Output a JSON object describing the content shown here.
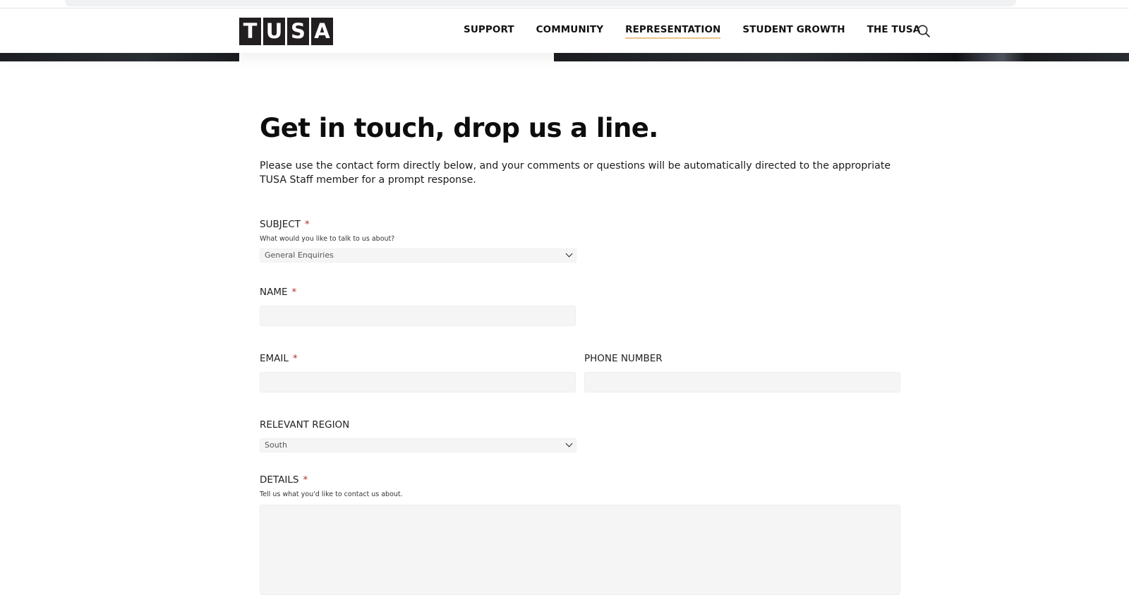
{
  "header": {
    "logo_letters": [
      "T",
      "U",
      "S",
      "A"
    ],
    "nav": [
      {
        "label": "SUPPORT",
        "active": false
      },
      {
        "label": "COMMUNITY",
        "active": false
      },
      {
        "label": "REPRESENTATION",
        "active": true
      },
      {
        "label": "STUDENT GROWTH",
        "active": false
      },
      {
        "label": "THE TUSA",
        "active": false
      }
    ],
    "search_icon": "search-icon"
  },
  "main": {
    "title": "Get in touch, drop us a line.",
    "intro": "Please use the contact form directly below, and your comments or questions will be automatically directed to the appropriate TUSA Staff member for a prompt response."
  },
  "form": {
    "required_marker": "*",
    "subject": {
      "label": "SUBJECT",
      "hint": "What would you like to talk to us about?",
      "value": "General Enquiries"
    },
    "name": {
      "label": "NAME",
      "value": ""
    },
    "email": {
      "label": "EMAIL",
      "value": ""
    },
    "phone": {
      "label": "PHONE NUMBER",
      "value": ""
    },
    "region": {
      "label": "RELEVANT REGION",
      "value": "South"
    },
    "details": {
      "label": "DETAILS",
      "hint": "Tell us what you'd like to contact us about.",
      "value": ""
    }
  },
  "colors": {
    "nav_active_underline": "#e9c48a",
    "required": "#b03030",
    "field_bg": "#f5f5f5",
    "logo_tile": "#231f20"
  }
}
